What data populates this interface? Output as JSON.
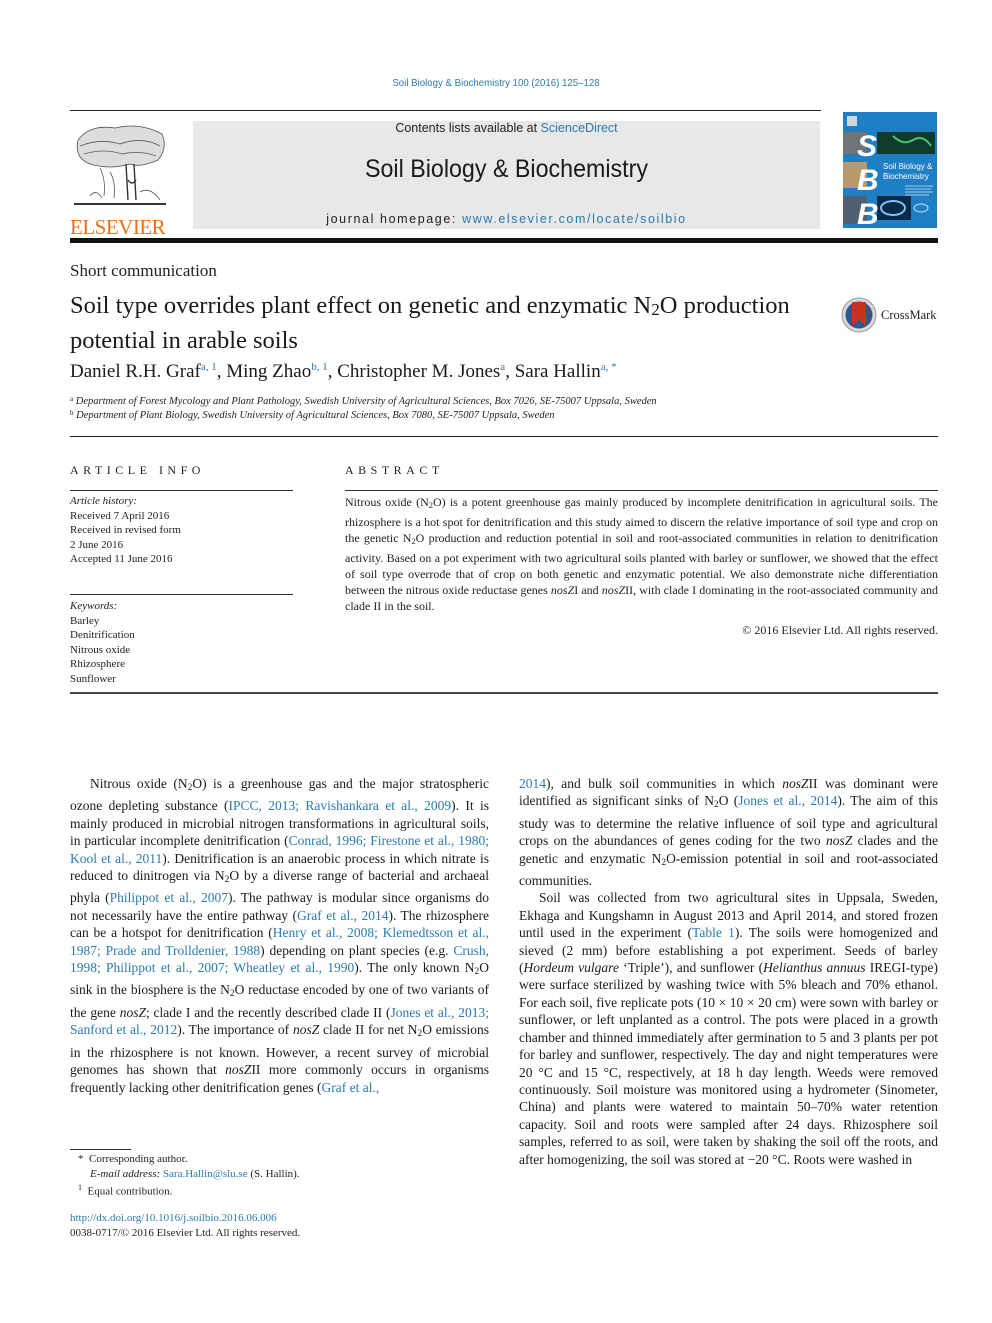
{
  "header": {
    "journal_reference": "Soil Biology & Biochemistry 100 (2016) 125–128",
    "contents_prefix": "Contents lists available at ",
    "contents_link": "ScienceDirect",
    "journal_title": "Soil Biology & Biochemistry",
    "homepage_prefix": "journal homepage: ",
    "homepage_link": "www.elsevier.com/locate/soilbio",
    "publisher_logo": "ELSEVIER",
    "cover": {
      "letters": [
        "S",
        "B",
        "B"
      ],
      "title_line1": "Soil Biology &",
      "title_line2": "Biochemistry"
    },
    "colors": {
      "link": "#2a7ab0",
      "elsevier_orange": "#e9711c",
      "cover_blue": "#1f7fc4",
      "banner_gray": "#e8e8e8"
    }
  },
  "article": {
    "type": "Short communication",
    "title_part1": "Soil type overrides plant effect on genetic and enzymatic N",
    "title_sub": "2",
    "title_part2": "O production potential in arable soils",
    "crossmark_label": "CrossMark",
    "authors": [
      {
        "name": "Daniel R.H. Graf",
        "sup": "a, 1"
      },
      {
        "name": "Ming Zhao",
        "sup": "b, 1"
      },
      {
        "name": "Christopher M. Jones",
        "sup": "a"
      },
      {
        "name": "Sara Hallin",
        "sup": "a, *"
      }
    ],
    "affiliations": [
      {
        "key": "a",
        "text": "Department of Forest Mycology and Plant Pathology, Swedish University of Agricultural Sciences, Box 7026, SE-75007 Uppsala, Sweden"
      },
      {
        "key": "b",
        "text": "Department of Plant Biology, Swedish University of Agricultural Sciences, Box 7080, SE-75007 Uppsala, Sweden"
      }
    ]
  },
  "article_info": {
    "heading": "ARTICLE INFO",
    "history_label": "Article history:",
    "history": [
      "Received 7 April 2016",
      "Received in revised form",
      "2 June 2016",
      "Accepted 11 June 2016"
    ],
    "keywords_label": "Keywords:",
    "keywords": [
      "Barley",
      "Denitrification",
      "Nitrous oxide",
      "Rhizosphere",
      "Sunflower"
    ]
  },
  "abstract": {
    "heading": "ABSTRACT",
    "p1": "Nitrous oxide (N",
    "p2": "O) is a potent greenhouse gas mainly produced by incomplete denitrification in agricultural soils. The rhizosphere is a hot spot for denitrification and this study aimed to discern the relative importance of soil type and crop on the genetic N",
    "p3": "O production and reduction potential in soil and root-associated communities in relation to denitrification activity. Based on a pot experiment with two agricultural soils planted with barley or sunflower, we showed that the effect of soil type overrode that of crop on both genetic and enzymatic potential. We also demonstrate niche differentiation between the nitrous oxide reductase genes ",
    "gene1": "nosZ",
    "p4": "I and ",
    "gene2": "nosZ",
    "p5": "II, with clade I dominating in the root-associated community and clade II in the soil.",
    "copyright": "© 2016 Elsevier Ltd. All rights reserved."
  },
  "body": {
    "left": {
      "s1": "Nitrous oxide (N",
      "s2": "O) is a greenhouse gas and the major stratospheric ozone depleting substance (",
      "c1": "IPCC, 2013; Ravishankara et al., 2009",
      "s3": "). It is mainly produced in microbial nitrogen transformations in agricultural soils, in particular incomplete denitrification (",
      "c2": "Conrad, 1996; Firestone et al., 1980; Kool et al., 2011",
      "s4": "). Denitrification is an anaerobic process in which nitrate is reduced to dinitrogen via N",
      "s5": "O by a diverse range of bacterial and archaeal phyla (",
      "c3": "Philippot et al., 2007",
      "s6": "). The pathway is modular since organisms do not necessarily have the entire pathway (",
      "c4": "Graf et al., 2014",
      "s7": "). The rhizosphere can be a hotspot for denitrification (",
      "c5": "Henry et al., 2008; Klemedtsson et al., 1987; Prade and Trolldenier, 1988",
      "s8": ") depending on plant species (e.g. ",
      "c6": "Crush, 1998; Philippot et al., 2007; Wheatley et al., 1990",
      "s9": "). The only known N",
      "s10": "O sink in the biosphere is the N",
      "s11": "O reductase encoded by one of two variants of the gene ",
      "g1": "nosZ",
      "s12": "; clade I and the recently described clade II (",
      "c7": "Jones et al., 2013; Sanford et al., 2012",
      "s13": "). The importance of ",
      "g2": "nosZ",
      "s14": " clade II for net N",
      "s15": "O emissions in the rhizosphere is not known. However, a recent survey of microbial genomes has shown that ",
      "g3": "nosZ",
      "s16": "II more commonly occurs in organisms frequently lacking other denitrification genes (",
      "c8": "Graf et al.,"
    },
    "right": {
      "c1": "2014",
      "s1": "), and bulk soil communities in which ",
      "g1": "nosZ",
      "s2": "II was dominant were identified as significant sinks of N",
      "s3": "O (",
      "c2": "Jones et al., 2014",
      "s4": "). The aim of this study was to determine the relative influence of soil type and agricultural crops on the abundances of genes coding for the two ",
      "g2": "nosZ",
      "s5": " clades and the genetic and enzymatic N",
      "s6": "O-emission potential in soil and root-associated communities.",
      "p2a": "Soil was collected from two agricultural sites in Uppsala, Sweden, Ekhaga and Kungshamn in August 2013 and April 2014, and stored frozen until used in the experiment (",
      "c3": "Table 1",
      "p2b": "). The soils were homogenized and sieved (2 mm) before establishing a pot experiment. Seeds of barley (",
      "sp1": "Hordeum vulgare",
      "p2c": " ‘Triple’), and sunflower (",
      "sp2": "Helianthus annuus",
      "p2d": " IREGI-type) were surface sterilized by washing twice with 5% bleach and 70% ethanol. For each soil, five replicate pots (10 × 10 × 20 cm) were sown with barley or sunflower, or left unplanted as a control. The pots were placed in a growth chamber and thinned immediately after germination to 5 and 3 plants per pot for barley and sunflower, respectively. The day and night temperatures were 20 °C and 15 °C, respectively, at 18 h day length. Weeds were removed continuously. Soil moisture was monitored using a hydrometer (Sinometer, China) and plants were watered to maintain 50–70% water retention capacity. Soil and roots were sampled after 24 days. Rhizosphere soil samples, referred to as soil, were taken by shaking the soil off the roots, and after homogenizing, the soil was stored at −20 °C. Roots were washed in"
    }
  },
  "footnotes": {
    "corresponding_mark": "*",
    "corresponding": "Corresponding author.",
    "email_label": "E-mail address:",
    "email": "Sara.Hallin@slu.se",
    "email_suffix": " (S. Hallin).",
    "equal_mark": "1",
    "equal": "Equal contribution.",
    "doi": "http://dx.doi.org/10.1016/j.soilbio.2016.06.006",
    "issn": "0038-0717/© 2016 Elsevier Ltd. All rights reserved."
  },
  "subscript_two": "2"
}
